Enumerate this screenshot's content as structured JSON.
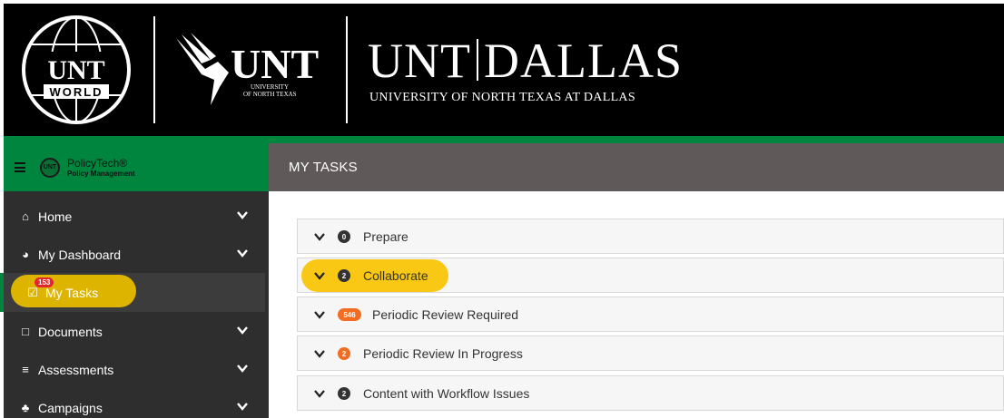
{
  "header": {
    "globe_top": "UNT",
    "globe_bottom": "WORLD",
    "logo_text": "UNT",
    "logo_sub_line1": "UNIVERSITY",
    "logo_sub_line2": "OF NORTH TEXAS",
    "dallas_left": "UNT",
    "dallas_right": "DALLAS",
    "dallas_subtitle": "UNIVERSITY OF NORTH TEXAS AT DALLAS"
  },
  "app": {
    "brand_name": "PolicyTech®",
    "brand_sub": "Policy Management",
    "logo_text": "UNT"
  },
  "sidebar": {
    "items": [
      {
        "label": "Home",
        "icon": "home-icon",
        "expandable": true
      },
      {
        "label": "My Dashboard",
        "icon": "dashboard-icon",
        "expandable": true
      },
      {
        "label": "My Tasks",
        "icon": "tasks-icon",
        "expandable": false,
        "active": true,
        "badge": "153"
      },
      {
        "label": "Documents",
        "icon": "document-icon",
        "expandable": true
      },
      {
        "label": "Assessments",
        "icon": "list-icon",
        "expandable": true
      },
      {
        "label": "Campaigns",
        "icon": "campaign-icon",
        "expandable": true
      }
    ]
  },
  "main": {
    "title": "MY TASKS",
    "tasks": [
      {
        "label": "Prepare",
        "count": "0",
        "badge_color": "#333333"
      },
      {
        "label": "Collaborate",
        "count": "2",
        "badge_color": "#333333",
        "highlighted": true
      },
      {
        "label": "Periodic Review Required",
        "count": "546",
        "badge_color": "#f26c22"
      },
      {
        "label": "Periodic Review In Progress",
        "count": "2",
        "badge_color": "#f26c22"
      },
      {
        "label": "Content with Workflow Issues",
        "count": "2",
        "badge_color": "#333333"
      }
    ]
  },
  "colors": {
    "brand_green": "#00853e",
    "highlight_yellow": "#f8c815",
    "alert_red": "#e3262b",
    "orange": "#f26c22"
  }
}
